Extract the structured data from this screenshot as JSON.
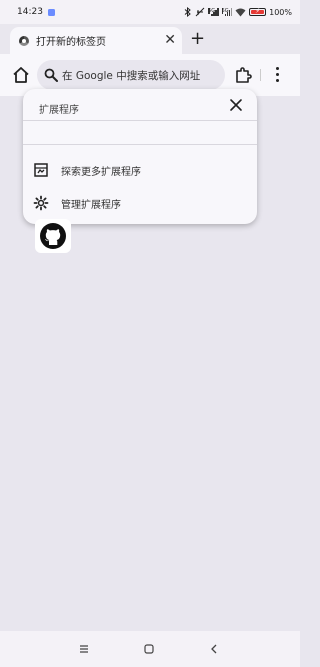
{
  "status_bar": {
    "time": "14:23",
    "signal_1_label": "5G",
    "signal_2_label": "5G",
    "battery_percent": "100%",
    "battery_level": 1.0,
    "accent_color": "#e53935"
  },
  "tab": {
    "title": "打开新的标签页",
    "close_glyph": "✕",
    "new_tab_glyph": "+"
  },
  "toolbar": {
    "search_placeholder": "在 Google 中搜索或输入网址"
  },
  "extensions_popup": {
    "title": "扩展程序",
    "items": [
      {
        "label": "探索更多扩展程序",
        "icon": "store-icon"
      },
      {
        "label": "管理扩展程序",
        "icon": "gear-icon"
      }
    ]
  },
  "shortcut": {
    "icon": "github-icon"
  },
  "nav_bar": {
    "icons": [
      "menu-lines-icon",
      "home-square-icon",
      "back-chevron-icon"
    ]
  }
}
